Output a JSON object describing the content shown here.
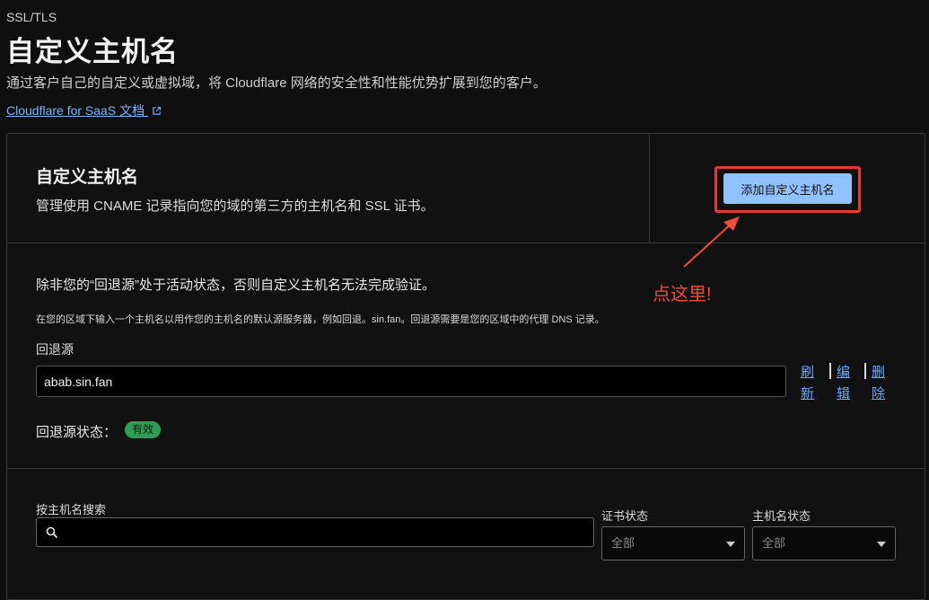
{
  "header": {
    "breadcrumb": "SSL/TLS",
    "title": "自定义主机名",
    "description": "通过客户自己的自定义或虚拟域，将 Cloudflare 网络的安全性和性能优势扩展到您的客户。",
    "doc_link": "Cloudflare for SaaS 文档"
  },
  "section": {
    "title": "自定义主机名",
    "description": "管理使用 CNAME 记录指向您的域的第三方的主机名和 SSL 证书。",
    "add_button": "添加自定义主机名"
  },
  "annotation": {
    "text": "点这里!",
    "color": "#f04a3a"
  },
  "fallback": {
    "warning": "除非您的“回退源”处于活动状态，否则自定义主机名无法完成验证。",
    "hint": "在您的区域下输入一个主机名以用作您的主机名的默认源服务器，例如回退。sin.fan。回退源需要是您的区域中的代理 DNS 记录。",
    "label": "回退源",
    "value": "abab.sin.fan",
    "actions": {
      "refresh": [
        "刷",
        "新"
      ],
      "edit": [
        "编",
        "辑"
      ],
      "delete": [
        "删",
        "除"
      ]
    },
    "status_label": "回退源状态：",
    "status_badge": "有效"
  },
  "filters": {
    "search_label": "按主机名搜索",
    "search_value": "",
    "cert_status_label": "证书状态",
    "cert_status_value": "全部",
    "host_status_label": "主机名状态",
    "host_status_value": "全部"
  },
  "colors": {
    "background": "#0f0f10",
    "accent_button": "#8fc2ff",
    "link": "#6aa8ff",
    "badge_green": "#2f9e55",
    "highlight_red": "#e8382f"
  }
}
